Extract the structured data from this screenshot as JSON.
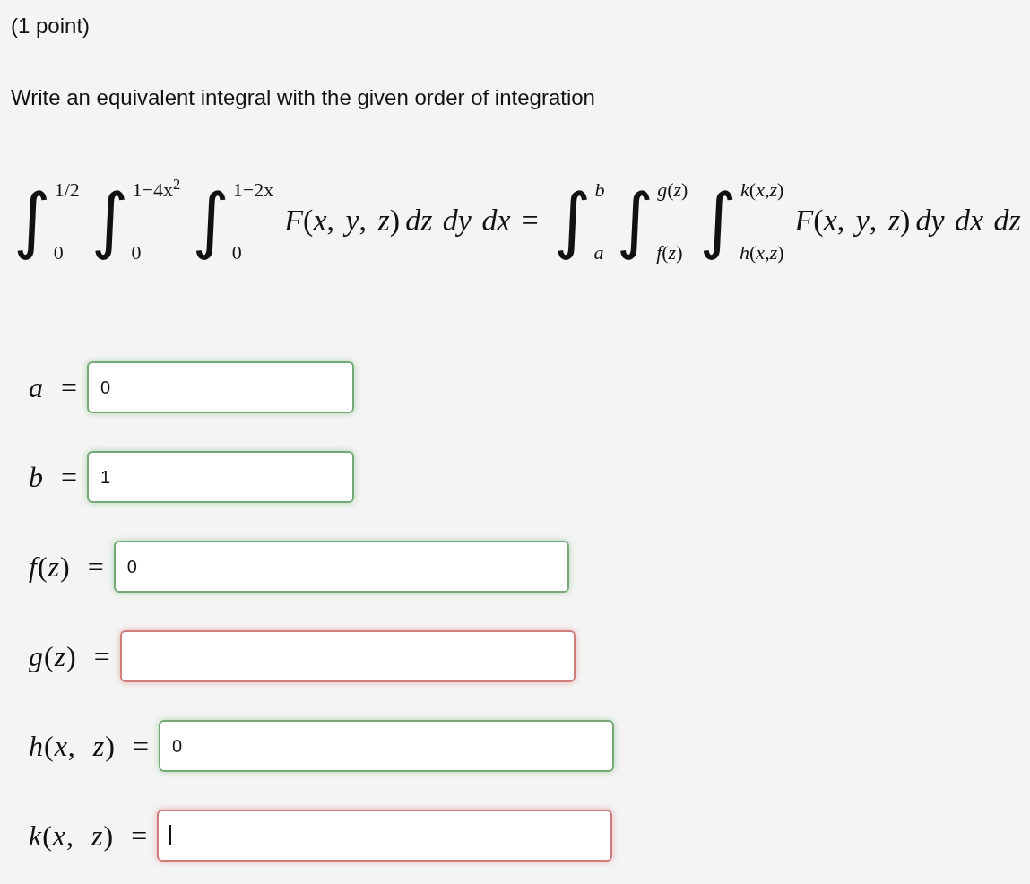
{
  "points": "(1 point)",
  "instruction": "Write an equivalent integral with the given order of integration",
  "equation": {
    "left": {
      "integrals": [
        {
          "sign": "∫",
          "upper": "1/2",
          "lower": "0"
        },
        {
          "sign": "∫",
          "upper": "1−4x$^{2}$",
          "lower": "0"
        },
        {
          "sign": "∫",
          "upper": "1−2x",
          "lower": "0"
        }
      ],
      "integrand": "*F*(*x*, *y*, *z*)",
      "differentials": "dz dy dx"
    },
    "relation": "=",
    "right": {
      "integrals": [
        {
          "sign": "∫",
          "upper": "*b*",
          "lower": "*a*"
        },
        {
          "sign": "∫",
          "upper": "*g*(*z*)",
          "lower": "*f*(*z*)"
        },
        {
          "sign": "∫",
          "upper": "*k*(*x*,*z*)",
          "lower": "*h*(*x*,*z*)"
        }
      ],
      "integrand": "*F*(*x*, *y*, *z*)",
      "differentials": "dy dx dz"
    }
  },
  "fields": [
    {
      "label": "*a* =",
      "value": "0",
      "correct": true,
      "focused": false
    },
    {
      "label": "*b* =",
      "value": "1",
      "correct": true,
      "focused": false
    },
    {
      "label": "*f*(*z*) =",
      "value": "0",
      "correct": true,
      "focused": false
    },
    {
      "label": "*g*(*z*) =",
      "correct": false,
      "focused": false
    },
    {
      "label": "*h*(*x*, *z*) =",
      "value": "0",
      "correct": true,
      "focused": false
    },
    {
      "label": "*k*(*x*, *z*) =",
      "correct": false,
      "focused": true
    }
  ]
}
